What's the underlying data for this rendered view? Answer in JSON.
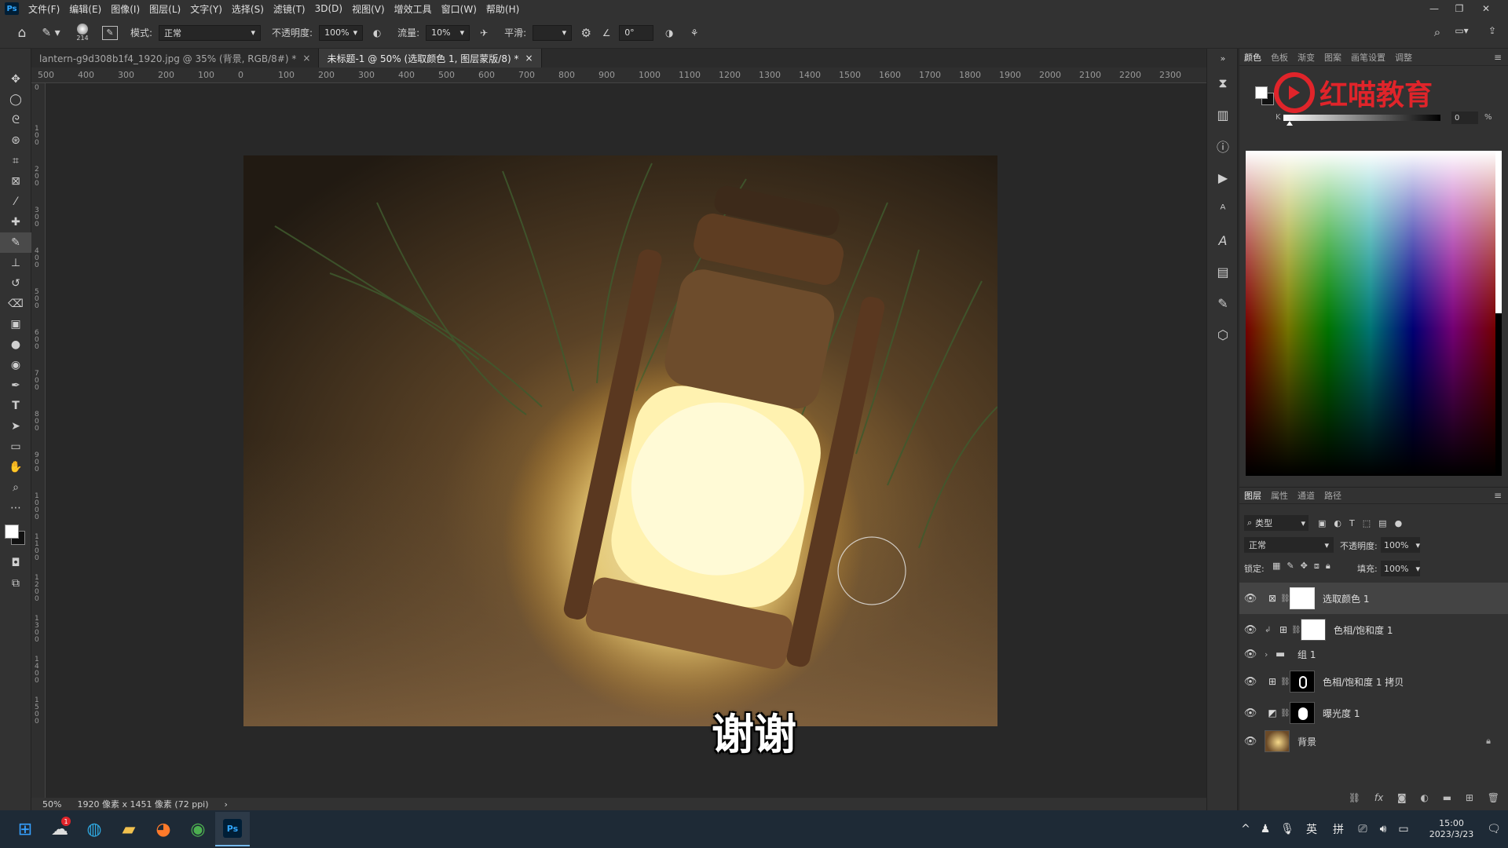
{
  "menubar": {
    "logo": "Ps",
    "items": [
      "文件(F)",
      "编辑(E)",
      "图像(I)",
      "图层(L)",
      "文字(Y)",
      "选择(S)",
      "滤镜(T)",
      "3D(D)",
      "视图(V)",
      "增效工具",
      "窗口(W)",
      "帮助(H)"
    ]
  },
  "options": {
    "brush_size": "214",
    "mode_label": "模式:",
    "mode_value": "正常",
    "opacity_label": "不透明度:",
    "opacity_value": "100%",
    "flow_label": "流量:",
    "flow_value": "10%",
    "smoothing_label": "平滑:",
    "angle_value": "0°"
  },
  "tabs": [
    {
      "label": "lantern-g9d308b1f4_1920.jpg @ 35% (背景, RGB/8#) *"
    },
    {
      "label": "未标题-1 @ 50% (选取颜色 1, 图层蒙版/8) *"
    }
  ],
  "ruler_h": [
    "500",
    "400",
    "300",
    "200",
    "100",
    "0",
    "100",
    "200",
    "300",
    "400",
    "500",
    "600",
    "700",
    "800",
    "900",
    "1000",
    "1100",
    "1200",
    "1300",
    "1400",
    "1500",
    "1600",
    "1700",
    "1800",
    "1900",
    "2000",
    "2100",
    "2200",
    "2300"
  ],
  "ruler_v": [
    "0",
    "1 0 0",
    "2 0 0",
    "3 0 0",
    "4 0 0",
    "5 0 0",
    "6 0 0",
    "7 0 0",
    "8 0 0",
    "9 0 0",
    "1 0 0 0",
    "1 1 0 0",
    "1 2 0 0",
    "1 3 0 0",
    "1 4 0 0",
    "1 5 0 0"
  ],
  "canvas": {
    "caption": "谢谢"
  },
  "status": {
    "zoom": "50%",
    "doc_info": "1920 像素 x 1451 像素 (72 ppi)"
  },
  "color_panel": {
    "tabs": [
      "颜色",
      "色板",
      "渐变",
      "图案",
      "画笔设置",
      "调整"
    ],
    "k_label": "K",
    "k_value": "0",
    "k_unit": "%",
    "watermark": "红喵教育"
  },
  "layers_panel": {
    "tabs": [
      "图层",
      "属性",
      "通道",
      "路径"
    ],
    "filter_label": "类型",
    "blend_mode": "正常",
    "opacity_label": "不透明度:",
    "opacity_value": "100%",
    "lock_label": "锁定:",
    "fill_label": "填充:",
    "fill_value": "100%",
    "layers": [
      {
        "name": "选取颜色 1"
      },
      {
        "name": "色相/饱和度 1"
      },
      {
        "name": "组 1"
      },
      {
        "name": "色相/饱和度 1 拷贝"
      },
      {
        "name": "曝光度 1"
      },
      {
        "name": "背景"
      }
    ]
  },
  "taskbar": {
    "ime_lang": "英",
    "ime_mode": "拼",
    "time": "15:00",
    "date": "2023/3/23",
    "badge": "1"
  },
  "colors": {
    "accent": "#31a8ff",
    "panel_bg": "#323232",
    "canvas_bg": "#282828",
    "watermark_red": "#e0242a"
  }
}
